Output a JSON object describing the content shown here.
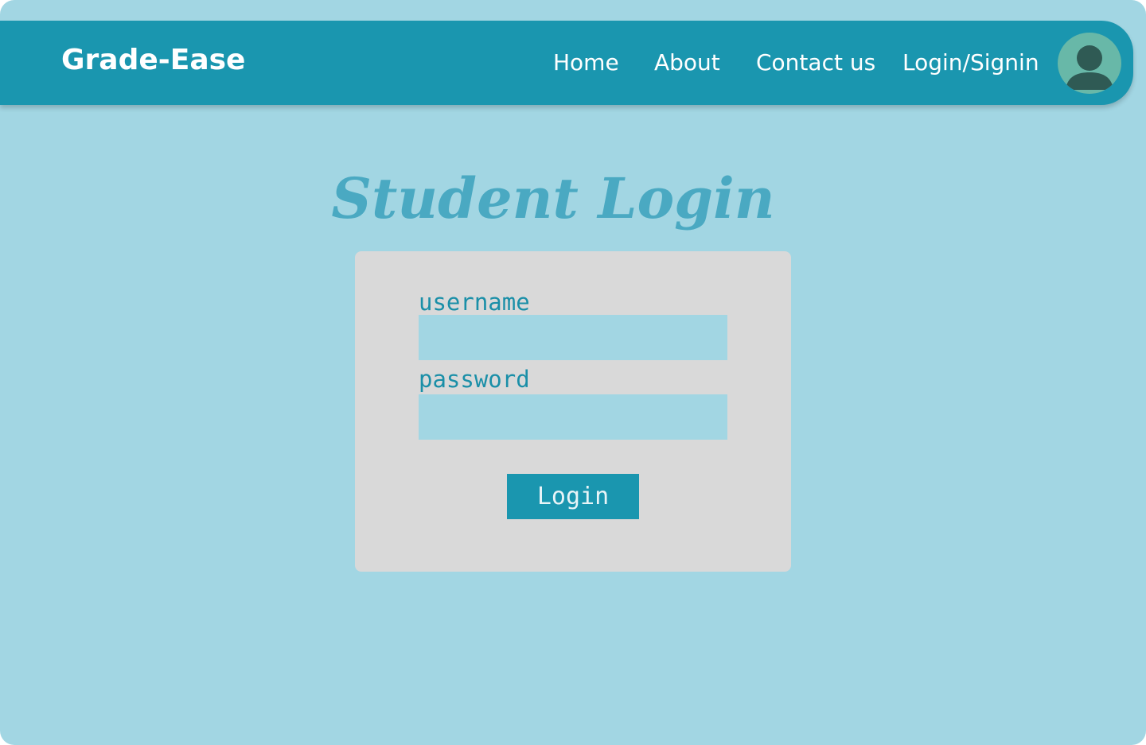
{
  "header": {
    "brand": "Grade-Ease",
    "nav": {
      "home": "Home",
      "about": "About",
      "contact": "Contact us",
      "login_signin": "Login/Signin"
    },
    "avatar_icon": "user-avatar-icon"
  },
  "main": {
    "title": "Student Login",
    "form": {
      "username_label": "username",
      "username_value": "",
      "password_label": "password",
      "password_value": "",
      "login_button": "Login"
    }
  },
  "colors": {
    "background": "#a2d6e3",
    "navbar": "#1a96af",
    "card": "#d9d9d9",
    "title": "#4aa9c2",
    "label": "#1a8fa8",
    "input": "#a2d6e3",
    "button": "#1a96af",
    "avatar_bg": "#68b8a8",
    "avatar_figure": "#2f5a54"
  }
}
